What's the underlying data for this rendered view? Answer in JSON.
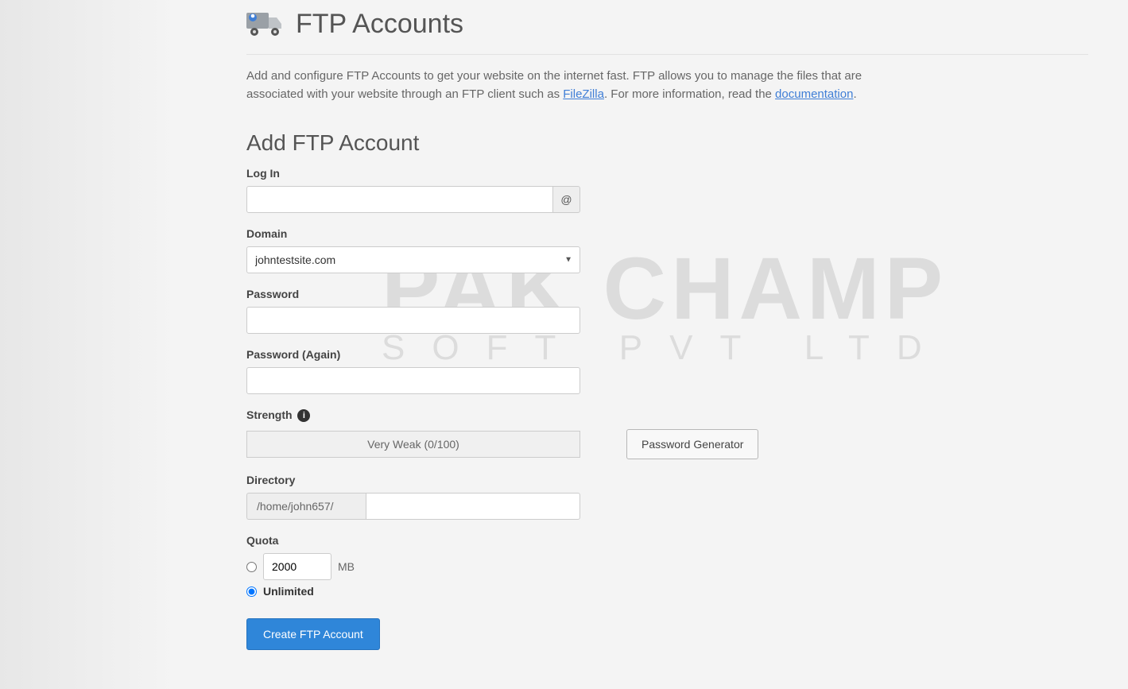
{
  "header": {
    "title": "FTP Accounts",
    "description_pre": "Add and configure FTP Accounts to get your website on the internet fast. FTP allows you to manage the files that are associated with your website through an FTP client such as ",
    "filezilla_link": "FileZilla",
    "description_mid": ". For more information, read the ",
    "docs_link": "documentation",
    "description_post": "."
  },
  "form": {
    "section_title": "Add FTP Account",
    "login_label": "Log In",
    "login_value": "",
    "at_symbol": "@",
    "domain_label": "Domain",
    "domain_value": "johntestsite.com",
    "password_label": "Password",
    "password_value": "",
    "password_again_label": "Password (Again)",
    "password_again_value": "",
    "strength_label": "Strength",
    "strength_text": "Very Weak (0/100)",
    "password_generator_label": "Password Generator",
    "directory_label": "Directory",
    "directory_prefix": "/home/john657/",
    "directory_value": "",
    "quota_label": "Quota",
    "quota_value": "2000",
    "quota_unit": "MB",
    "quota_unlimited_label": "Unlimited",
    "submit_label": "Create FTP Account"
  },
  "watermark": {
    "line1": "PAK CHAMP",
    "line2": "SOFT PVT LTD"
  }
}
